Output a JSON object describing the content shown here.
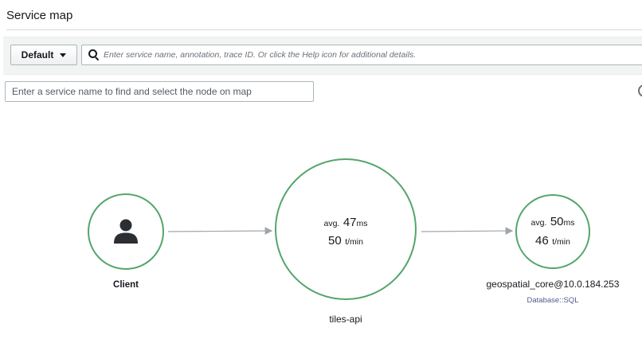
{
  "header": {
    "title": "Service map"
  },
  "toolbar": {
    "group_label": "Default",
    "filter_placeholder": "Enter service name, annotation, trace ID. Or click the Help icon for additional details."
  },
  "node_search": {
    "placeholder": "Enter a service name to find and select the node on map"
  },
  "colors": {
    "healthy": "#54a56c",
    "edge": "#a0a6ab"
  },
  "nodes": {
    "client": {
      "name": "Client",
      "icon": "user-icon"
    },
    "tiles_api": {
      "name": "tiles-api",
      "avg_prefix": "avg.",
      "latency_value": "47",
      "latency_unit": "ms",
      "throughput_value": "50",
      "throughput_unit": "t/min"
    },
    "geospatial_core": {
      "name": "geospatial_core@10.0.184.253",
      "type": "Database::SQL",
      "avg_prefix": "avg.",
      "latency_value": "50",
      "latency_unit": "ms",
      "throughput_value": "46",
      "throughput_unit": "t/min"
    }
  }
}
